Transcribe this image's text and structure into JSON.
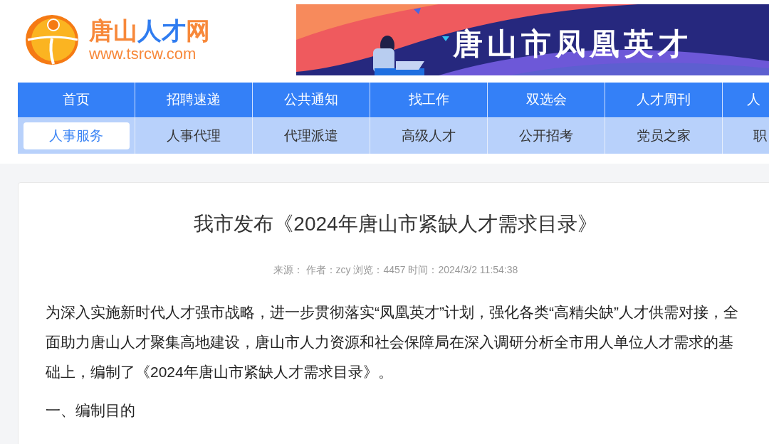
{
  "logo": {
    "name_parts": [
      {
        "text": "唐山",
        "color": "#f7883a"
      },
      {
        "text": "人才",
        "color": "#2f7cf0"
      },
      {
        "text": "网",
        "color": "#f7883a"
      }
    ],
    "url": "www.tsrcw.com"
  },
  "banner": {
    "title": "唐山市凤凰英才"
  },
  "nav": {
    "main": [
      {
        "label": "首页"
      },
      {
        "label": "招聘速递"
      },
      {
        "label": "公共通知"
      },
      {
        "label": "找工作"
      },
      {
        "label": "双选会"
      },
      {
        "label": "人才周刊"
      },
      {
        "label": "人"
      }
    ],
    "sub": [
      {
        "label": "人事服务",
        "selected": true
      },
      {
        "label": "人事代理",
        "selected": false
      },
      {
        "label": "代理派遣",
        "selected": false
      },
      {
        "label": "高级人才",
        "selected": false
      },
      {
        "label": "公开招考",
        "selected": false
      },
      {
        "label": "党员之家",
        "selected": false
      },
      {
        "label": "职",
        "selected": false
      }
    ]
  },
  "article": {
    "title": "我市发布《2024年唐山市紧缺人才需求目录》",
    "meta": "来源： 作者：zcy 浏览：4457 时间：2024/3/2 11:54:38",
    "paragraphs": [
      "为深入实施新时代人才强市战略，进一步贯彻落实“凤凰英才”计划，强化各类“高精尖缺”人才供需对接，全面助力唐山人才聚集高地建设，唐山市人力资源和社会保障局在深入调研分析全市用人单位人才需求的基础上，编制了《2024年唐山市紧缺人才需求目录》。",
      "一、编制目的"
    ]
  }
}
